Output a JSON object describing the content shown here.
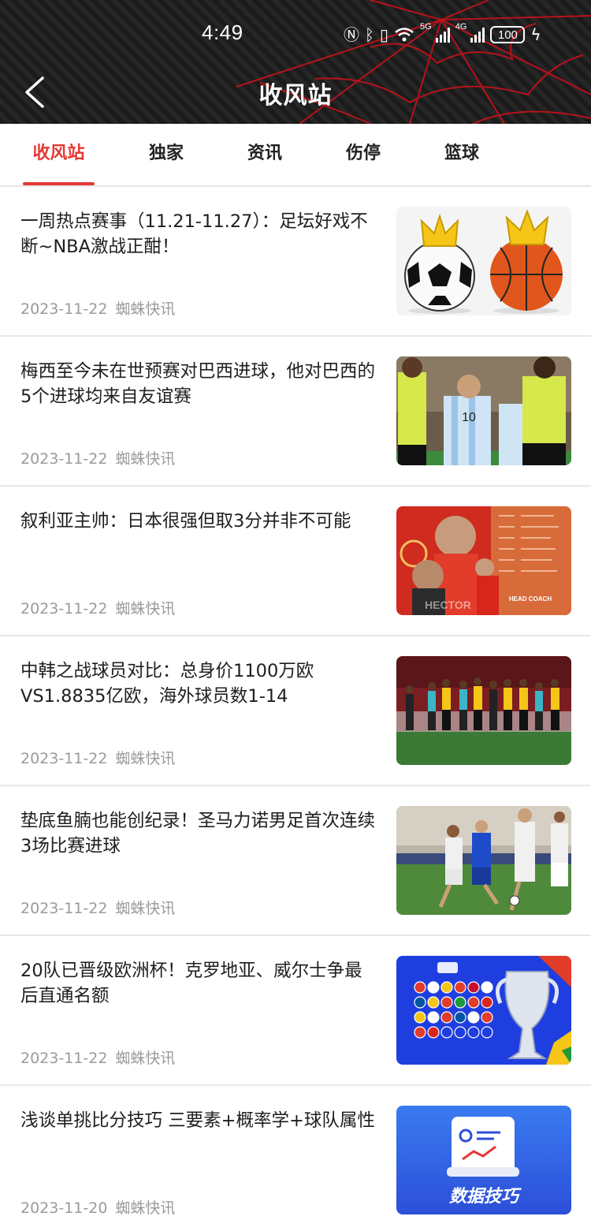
{
  "status_bar": {
    "time": "4:49",
    "battery": "100",
    "net_5g": "5G",
    "net_4g": "4G"
  },
  "header": {
    "title": "收风站"
  },
  "tabs": [
    {
      "label": "收风站",
      "active": true
    },
    {
      "label": "独家",
      "active": false
    },
    {
      "label": "资讯",
      "active": false
    },
    {
      "label": "伤停",
      "active": false
    },
    {
      "label": "篮球",
      "active": false
    }
  ],
  "articles": [
    {
      "title": "一周热点赛事（11.21-11.27）：足坛好戏不断~NBA激战正酣！",
      "date": "2023-11-22",
      "source": "蜘蛛快讯",
      "image": "crowned-balls"
    },
    {
      "title": "梅西至今未在世预赛对巴西进球，他对巴西的5个进球均来自友谊赛",
      "date": "2023-11-22",
      "source": "蜘蛛快讯",
      "image": "messi-referee"
    },
    {
      "title": "叙利亚主帅：日本很强但取3分并非不可能",
      "date": "2023-11-22",
      "source": "蜘蛛快讯",
      "image": "coach-poster"
    },
    {
      "title": "中韩之战球员对比：总身价1100万欧VS1.8835亿欧，海外球员数1-14",
      "date": "2023-11-22",
      "source": "蜘蛛快讯",
      "image": "team-training"
    },
    {
      "title": "垫底鱼腩也能创纪录！圣马力诺男足首次连续3场比赛进球",
      "date": "2023-11-22",
      "source": "蜘蛛快讯",
      "image": "match-action"
    },
    {
      "title": "20队已晋级欧洲杯！克罗地亚、威尔士争最后直通名额",
      "date": "2023-11-22",
      "source": "蜘蛛快讯",
      "image": "euro-trophy"
    },
    {
      "title": "浅谈单挑比分技巧 三要素+概率学+球队属性",
      "date": "2023-11-20",
      "source": "蜘蛛快讯",
      "image": "data-tips",
      "image_caption": "数据技巧"
    }
  ],
  "colors": {
    "accent": "#e53935",
    "header_bg": "#1d1d1d",
    "web_red": "#c0121b"
  }
}
